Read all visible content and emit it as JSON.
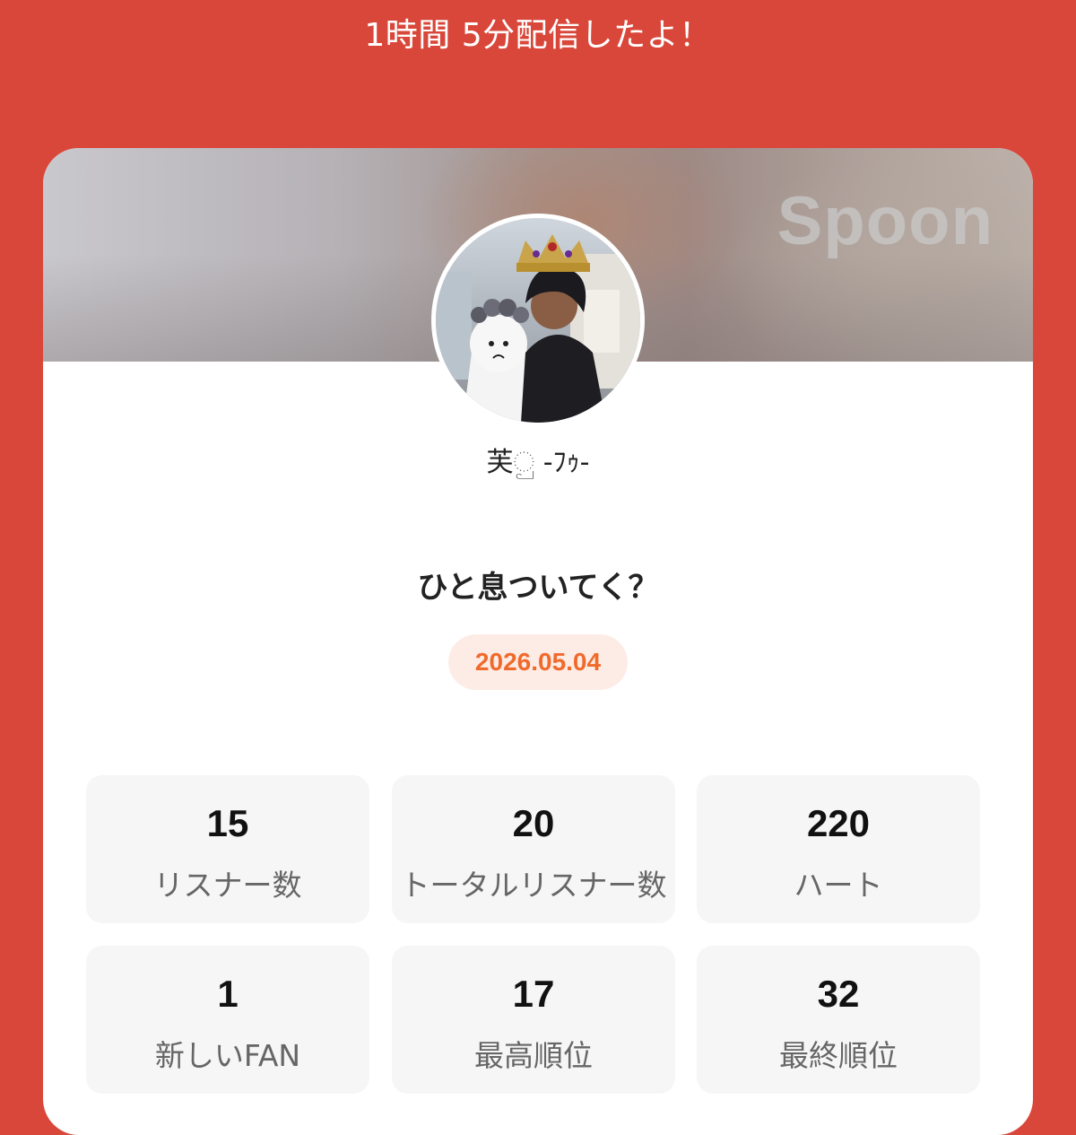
{
  "header": {
    "stream_summary": "1時間 5分配信したよ！"
  },
  "card": {
    "logo_text": "Spoon",
    "username": "芙ු -ﾌｩ-",
    "broadcast_title": "ひと息ついてく？",
    "date": "2026.05.04"
  },
  "stats": [
    {
      "value": "15",
      "label": "リスナー数"
    },
    {
      "value": "20",
      "label": "トータルリスナー数"
    },
    {
      "value": "220",
      "label": "ハート"
    },
    {
      "value": "1",
      "label": "新しいFAN"
    },
    {
      "value": "17",
      "label": "最高順位"
    },
    {
      "value": "32",
      "label": "最終順位"
    }
  ],
  "colors": {
    "background": "#d9473a",
    "card": "#ffffff",
    "accent": "#f06a2c",
    "date_pill_bg": "#fdece6",
    "stat_bg": "#f6f6f6"
  }
}
